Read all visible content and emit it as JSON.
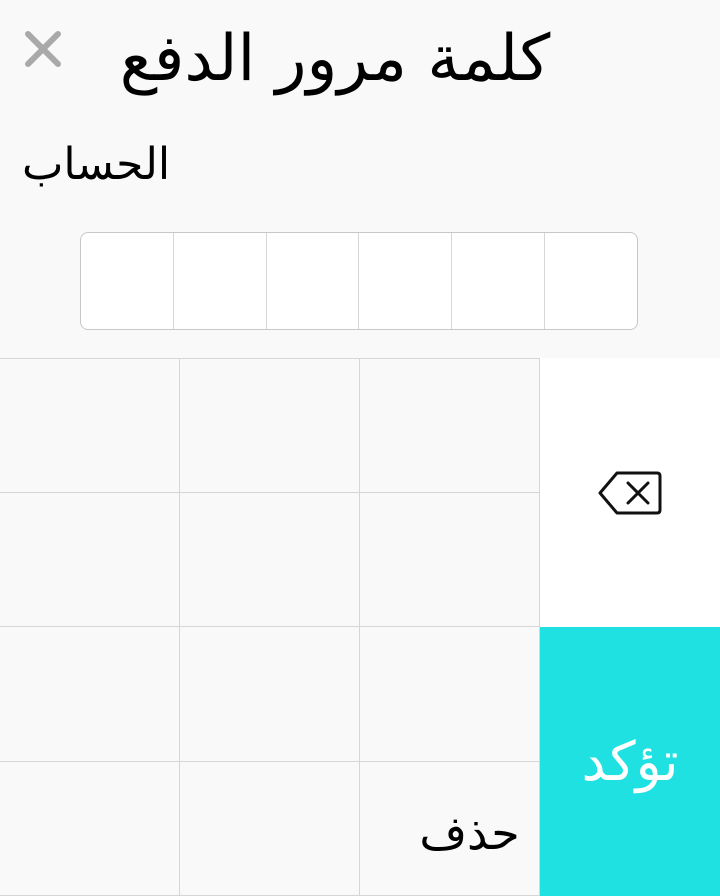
{
  "header": {
    "title": "كلمة مرور الدفع",
    "account_label": "الحساب"
  },
  "pin": {
    "length": 6
  },
  "keypad": {
    "delete_label": "حذف",
    "confirm_label": "تؤكد",
    "confirm_color": "#20e1e1",
    "icons": {
      "close": "close-icon",
      "backspace": "backspace-icon"
    }
  }
}
